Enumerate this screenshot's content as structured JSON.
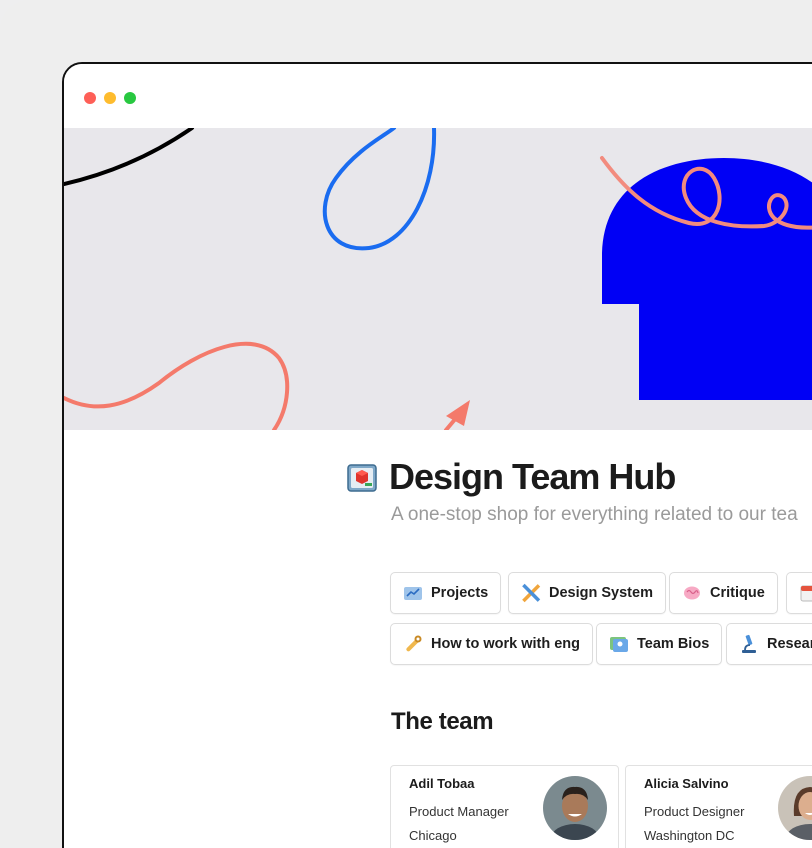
{
  "window": {
    "controls": [
      "close",
      "minimize",
      "maximize"
    ]
  },
  "page": {
    "icon": "blueprint-cube-icon",
    "title": "Design Team Hub",
    "subtitle": "A one-stop shop for everything related to our tea"
  },
  "links": [
    {
      "label": "Projects",
      "icon": "chart-board-icon"
    },
    {
      "label": "Design System",
      "icon": "pencil-ruler-icon"
    },
    {
      "label": "Critique",
      "icon": "brain-icon"
    },
    {
      "label": "",
      "icon": "calendar-icon"
    },
    {
      "label": "How to work with eng",
      "icon": "wrench-icon"
    },
    {
      "label": "Team Bios",
      "icon": "id-card-icon"
    },
    {
      "label": "Resear",
      "icon": "microscope-icon"
    }
  ],
  "team": {
    "heading": "The team",
    "members": [
      {
        "name": "Adil Tobaa",
        "role": "Product Manager",
        "city": "Chicago"
      },
      {
        "name": "Alicia Salvino",
        "role": "Product Designer",
        "city": "Washington DC"
      }
    ]
  },
  "colors": {
    "cover_bg": "#e8e7eb",
    "head_blue": "#0000f5",
    "coral": "#f47a6b",
    "loop_blue": "#1a6cf0"
  }
}
